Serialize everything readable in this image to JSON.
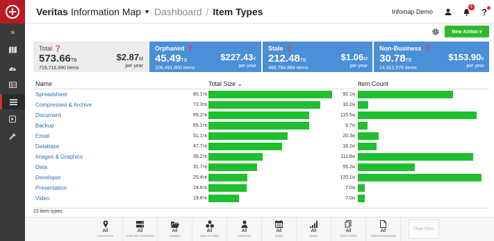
{
  "header": {
    "app_name_bold": "Veritas",
    "app_name_rest": "Information Map",
    "dashboard": "Dashboard",
    "separator": "/",
    "current": "Item Types",
    "user": "Infomap Demo",
    "notifications_count": "1",
    "help": "?"
  },
  "actions": {
    "new_action": "New Action ▾"
  },
  "summary": {
    "total": {
      "title": "Total ❓",
      "size": "573.66",
      "size_unit": "TB",
      "items": "719,716,990 items",
      "cost": "$2.87",
      "cost_unit": "M",
      "per_year": "per year"
    },
    "orphaned": {
      "title": "Orphaned ❓",
      "size": "45.49",
      "size_unit": "TB",
      "items": "106,491,800 items",
      "cost": "$227.43",
      "cost_unit": "K",
      "per_year": "per year"
    },
    "stale": {
      "title": "Stale ❓",
      "size": "212.48",
      "size_unit": "TB",
      "items": "466,764,864 items",
      "cost": "$1.06",
      "cost_unit": "M",
      "per_year": "per year"
    },
    "non_business": {
      "title": "Non-Business ❓",
      "size": "30.78",
      "size_unit": "TB",
      "items": "14,312,578 items",
      "cost": "$153.90",
      "cost_unit": "K",
      "per_year": "per year"
    }
  },
  "table": {
    "col_name": "Name",
    "col_size": "Total Size ⌄",
    "col_count": "Item Count",
    "footer": "23 item types",
    "rows": [
      {
        "name": "Spreadsheet",
        "size": "80.1",
        "size_unit": "TB",
        "count": "92.1",
        "count_unit": "M",
        "size_value": 80.1,
        "count_value": 92.1
      },
      {
        "name": "Compressed & Archive",
        "size": "72.3",
        "size_unit": "TB",
        "count": "10.2",
        "count_unit": "M",
        "size_value": 72.3,
        "count_value": 10.2
      },
      {
        "name": "Document",
        "size": "65.2",
        "size_unit": "TB",
        "count": "115.5",
        "count_unit": "M",
        "size_value": 65.2,
        "count_value": 115.5
      },
      {
        "name": "Backup",
        "size": "65.1",
        "size_unit": "TB",
        "count": "9.7",
        "count_unit": "M",
        "size_value": 65.1,
        "count_value": 9.7
      },
      {
        "name": "Email",
        "size": "51.1",
        "size_unit": "TB",
        "count": "20.3",
        "count_unit": "M",
        "size_value": 51.1,
        "count_value": 20.3
      },
      {
        "name": "Database",
        "size": "47.7",
        "size_unit": "TB",
        "count": "18.2",
        "count_unit": "M",
        "size_value": 47.7,
        "count_value": 18.2
      },
      {
        "name": "Images & Graphics",
        "size": "35.2",
        "size_unit": "TB",
        "count": "111.8",
        "count_unit": "M",
        "size_value": 35.2,
        "count_value": 111.8
      },
      {
        "name": "Data",
        "size": "31.7",
        "size_unit": "TB",
        "count": "55.2",
        "count_unit": "M",
        "size_value": 31.7,
        "count_value": 55.2
      },
      {
        "name": "Developer",
        "size": "25.4",
        "size_unit": "TB",
        "count": "120.1",
        "count_unit": "M",
        "size_value": 25.4,
        "count_value": 120.1
      },
      {
        "name": "Presentation",
        "size": "24.6",
        "size_unit": "TB",
        "count": "7.0",
        "count_unit": "M",
        "size_value": 24.6,
        "count_value": 7.0
      },
      {
        "name": "Video",
        "size": "19.6",
        "size_unit": "TB",
        "count": "7.0",
        "count_unit": "M",
        "size_value": 19.6,
        "count_value": 7.0
      }
    ]
  },
  "filters": [
    {
      "value": "All",
      "label": "Locations",
      "icon": "location-pin-icon"
    },
    {
      "value": "All",
      "label": "Content Sources",
      "icon": "server-icon"
    },
    {
      "value": "All",
      "label": "Shares",
      "icon": "folder-icon"
    },
    {
      "value": "All",
      "label": "Data Stores",
      "icon": "data-stores-icon"
    },
    {
      "value": "All",
      "label": "Owners",
      "icon": "user-icon"
    },
    {
      "value": "All",
      "label": "Ages",
      "icon": "calendar-icon"
    },
    {
      "value": "All",
      "label": "Sizes",
      "icon": "bar-chart-icon"
    },
    {
      "value": "All",
      "label": "Item Types",
      "icon": "item-types-icon"
    },
    {
      "value": "All",
      "label": "Item Extensions",
      "icon": "file-icon"
    }
  ],
  "clear_filters": "Clear filters",
  "colors": {
    "accent_red": "#b81c22",
    "card_blue": "#4a8fd8",
    "bar_green": "#1fbf2f",
    "button_green": "#2eb82e",
    "link_blue": "#2a6ebd"
  },
  "sidebar_icons": [
    "chevrons-right-icon",
    "map-icon",
    "dashboard-icon",
    "table-icon",
    "list-icon",
    "play-icon",
    "wrench-icon"
  ]
}
